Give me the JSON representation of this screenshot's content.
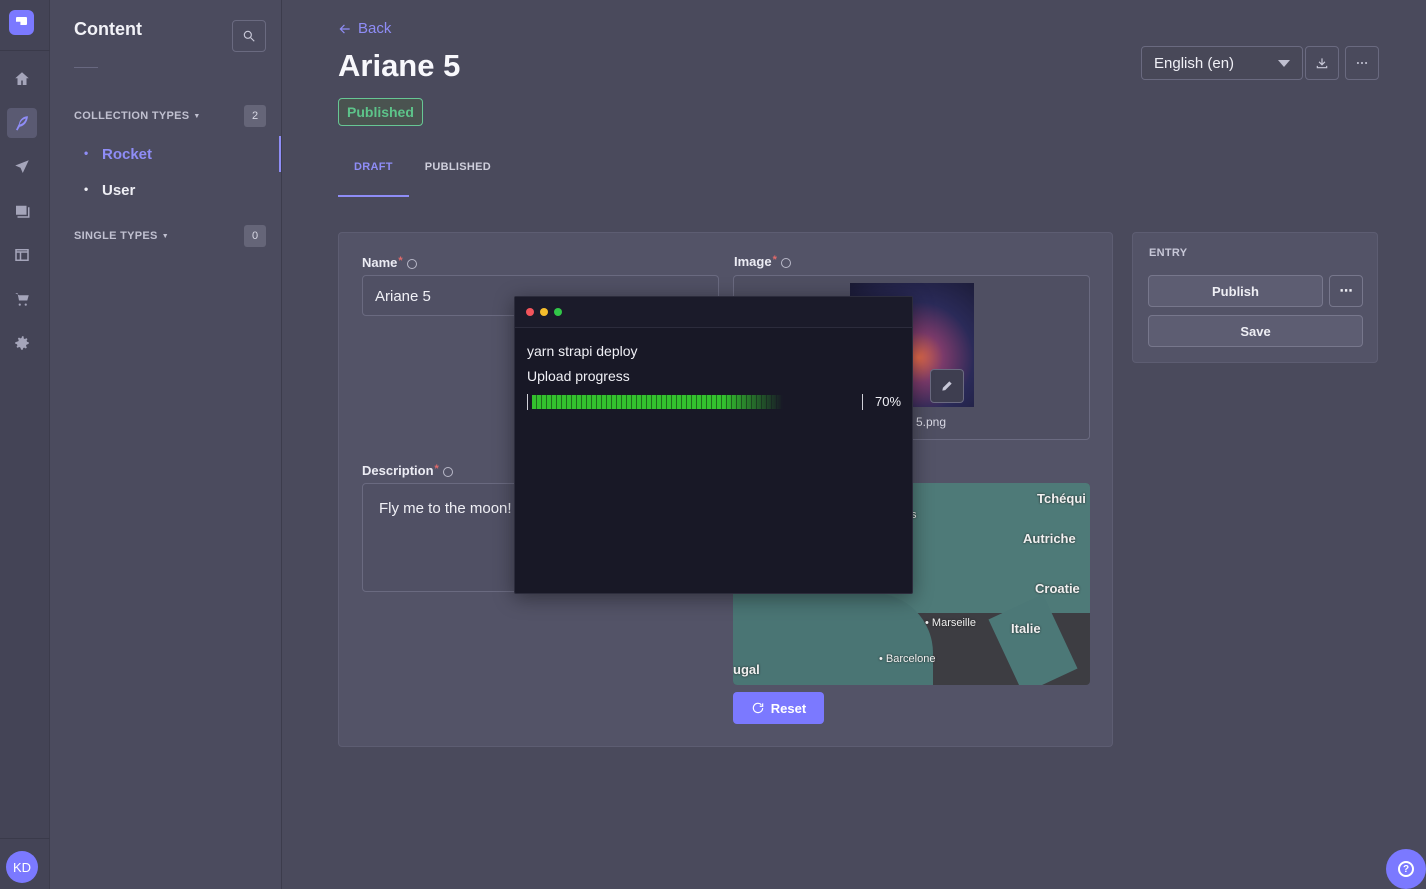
{
  "sidebar": {
    "title": "Content",
    "collection_types": {
      "label": "COLLECTION TYPES",
      "count": "2",
      "items": [
        {
          "label": "Rocket"
        },
        {
          "label": "User"
        }
      ]
    },
    "single_types": {
      "label": "SINGLE TYPES",
      "count": "0"
    }
  },
  "user": {
    "initials": "KD"
  },
  "header": {
    "back_label": "Back",
    "title": "Ariane 5",
    "status": "Published",
    "locale": "English (en)",
    "tabs": [
      {
        "label": "DRAFT"
      },
      {
        "label": "PUBLISHED"
      }
    ]
  },
  "form": {
    "name": {
      "label": "Name",
      "value": "Ariane 5"
    },
    "image": {
      "label": "Image",
      "filename": "5.png"
    },
    "description": {
      "label": "Description",
      "value": "Fly me to the moon!"
    },
    "map": {
      "labels": [
        "Tchéqui",
        "Autriche",
        "Croatie",
        "Italie",
        "ugal",
        "s"
      ],
      "cities": [
        "Marseille",
        "Barcelone"
      ]
    },
    "reset_label": "Reset"
  },
  "entry": {
    "title": "ENTRY",
    "publish_label": "Publish",
    "save_label": "Save"
  },
  "terminal": {
    "command": "yarn strapi deploy",
    "progress_label": "Upload progress",
    "progress_value": 0.7,
    "progress_text": "70%"
  },
  "colors": {
    "accent": "#7b79ff",
    "success": "#5dc48a",
    "progress": "#33c12e"
  }
}
